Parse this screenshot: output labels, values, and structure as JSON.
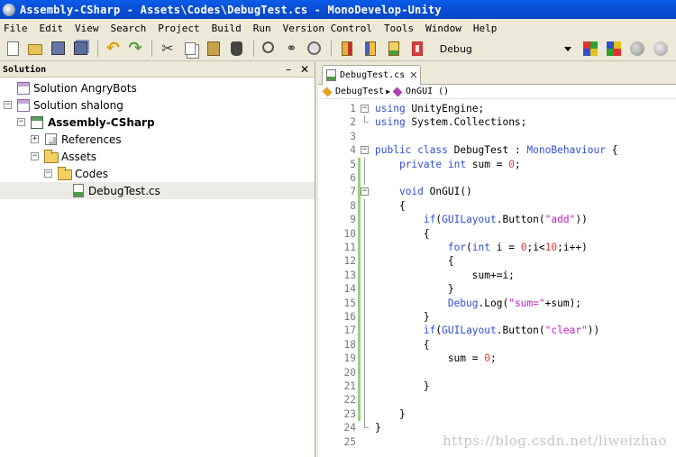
{
  "window": {
    "title": "Assembly-CSharp - Assets\\Codes\\DebugTest.cs - MonoDevelop-Unity"
  },
  "menu": [
    "File",
    "Edit",
    "View",
    "Search",
    "Project",
    "Build",
    "Run",
    "Version Control",
    "Tools",
    "Window",
    "Help"
  ],
  "toolbar": {
    "configuration": "Debug"
  },
  "solution_pane": {
    "title": "Solution",
    "minimize": "–",
    "close": "✕",
    "items": [
      {
        "label": "Solution AngryBots",
        "bold": false
      },
      {
        "label": "Solution shalong",
        "bold": false
      },
      {
        "label": "Assembly-CSharp",
        "bold": true
      },
      {
        "label": "References",
        "bold": false
      },
      {
        "label": "Assets",
        "bold": false
      },
      {
        "label": "Codes",
        "bold": false
      },
      {
        "label": "DebugTest.cs",
        "bold": false
      }
    ]
  },
  "editor": {
    "tab_label": "DebugTest.cs",
    "tab_close": "✕",
    "path": {
      "class": "DebugTest",
      "method": "OnGUI ()"
    },
    "lines": [
      "using UnityEngine;",
      "using System.Collections;",
      "",
      "public class DebugTest : MonoBehaviour {",
      "    private int sum = 0;",
      "",
      "    void OnGUI()",
      "    {",
      "        if(GUILayout.Button(\"add\"))",
      "        {",
      "            for(int i = 0;i<10;i++)",
      "            {",
      "                sum+=i;",
      "            }",
      "            Debug.Log(\"sum=\"+sum);",
      "        }",
      "        if(GUILayout.Button(\"clear\"))",
      "        {",
      "            sum = 0;",
      "",
      "        }",
      "",
      "    }",
      "}",
      ""
    ]
  },
  "watermark": "https://blog.csdn.net/liweizhao"
}
